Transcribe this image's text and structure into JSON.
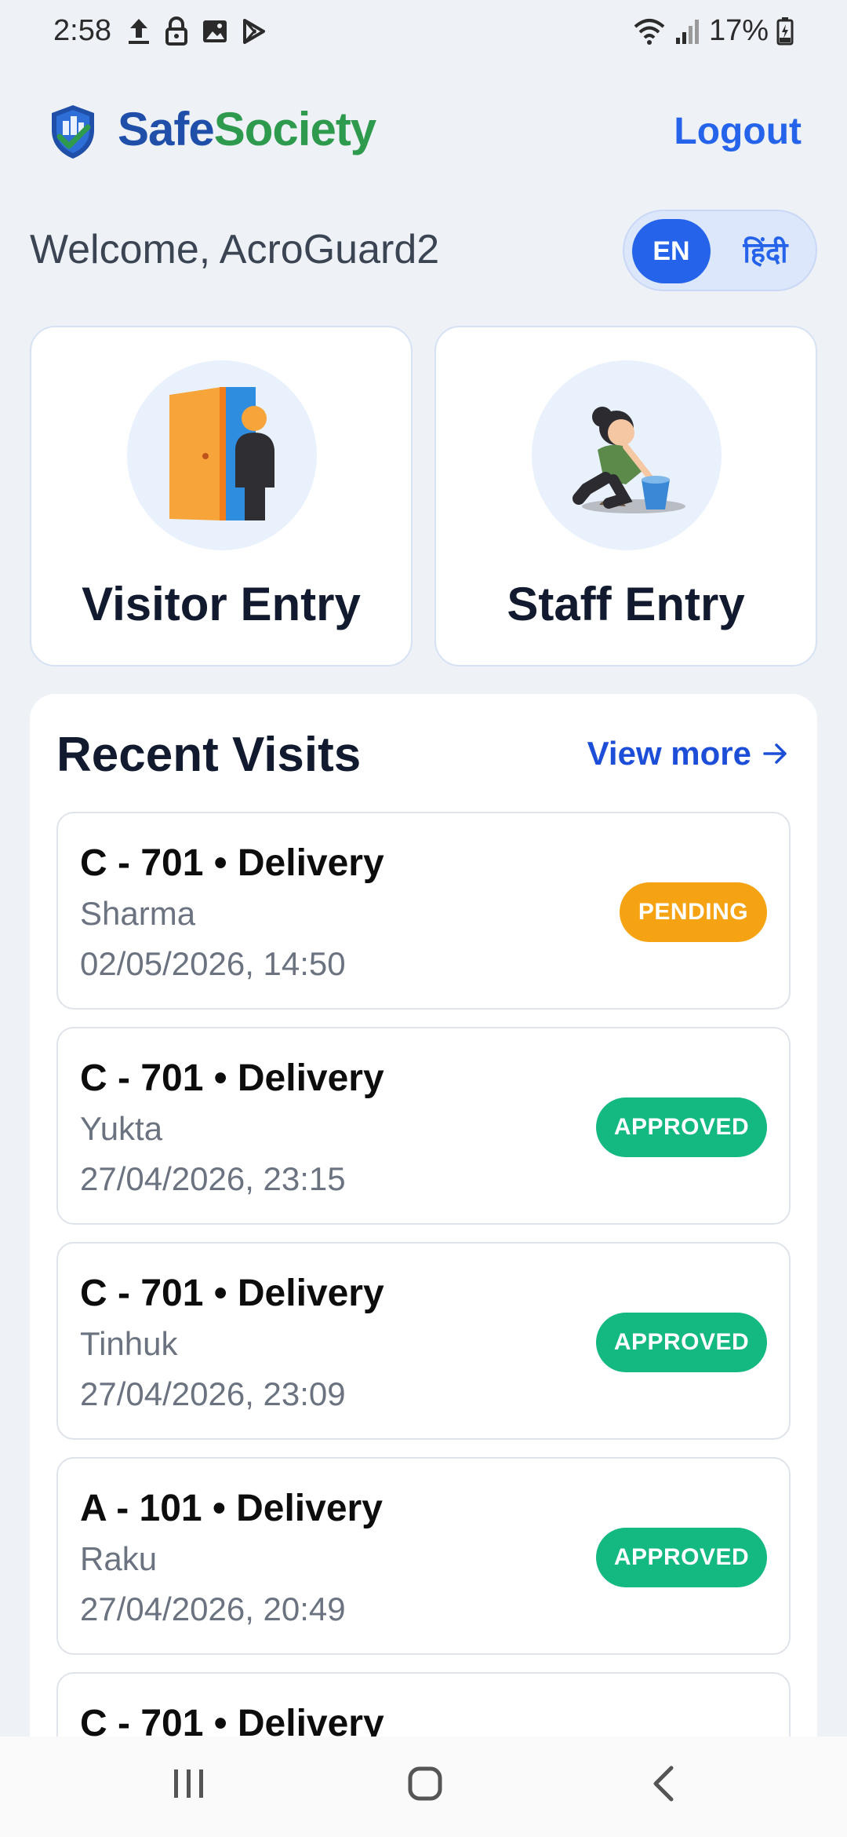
{
  "status_bar": {
    "time": "2:58",
    "battery": "17%"
  },
  "header": {
    "app_name_part1": "Safe",
    "app_name_part2": "Society",
    "logout_label": "Logout"
  },
  "welcome": {
    "text": "Welcome, AcroGuard2"
  },
  "language": {
    "active": "EN",
    "alternate": "हिंदी"
  },
  "entries": {
    "visitor_label": "Visitor Entry",
    "staff_label": "Staff Entry"
  },
  "recent": {
    "title": "Recent Visits",
    "view_more_label": "View more",
    "visits": [
      {
        "title": "C - 701 • Delivery",
        "name": "Sharma",
        "datetime": "02/05/2026, 14:50",
        "status": "PENDING"
      },
      {
        "title": "C - 701 • Delivery",
        "name": "Yukta",
        "datetime": "27/04/2026, 23:15",
        "status": "APPROVED"
      },
      {
        "title": "C - 701 • Delivery",
        "name": "Tinhuk",
        "datetime": "27/04/2026, 23:09",
        "status": "APPROVED"
      },
      {
        "title": "A - 101 • Delivery",
        "name": "Raku",
        "datetime": "27/04/2026, 20:49",
        "status": "APPROVED"
      },
      {
        "title": "C - 701 • Delivery",
        "name": "",
        "datetime": "",
        "status": ""
      }
    ]
  },
  "colors": {
    "accent": "#2563eb",
    "pending": "#f5a313",
    "approved": "#14b881",
    "background": "#eef1f6"
  }
}
